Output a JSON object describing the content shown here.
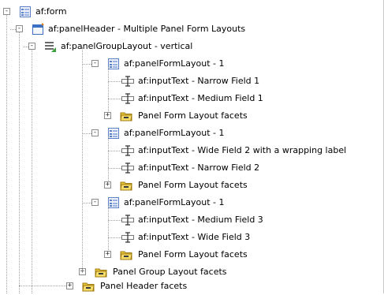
{
  "tree": {
    "nodes": [
      {
        "label": "af:form",
        "icon": "form-icon",
        "toggle": "-"
      },
      {
        "label": "af:panelHeader - Multiple Panel Form Layouts",
        "icon": "panel-header-icon",
        "toggle": "-"
      },
      {
        "label": "af:panelGroupLayout - vertical",
        "icon": "panel-group-layout-icon",
        "toggle": "-"
      },
      {
        "label": "af:panelFormLayout - 1",
        "icon": "panel-form-layout-icon",
        "toggle": "-"
      },
      {
        "label": "af:inputText - Narrow Field 1",
        "icon": "input-text-icon",
        "toggle": ""
      },
      {
        "label": "af:inputText - Medium Field 1",
        "icon": "input-text-icon",
        "toggle": ""
      },
      {
        "label": "Panel Form Layout facets",
        "icon": "facets-folder-icon",
        "toggle": "+"
      },
      {
        "label": "af:panelFormLayout - 1",
        "icon": "panel-form-layout-icon",
        "toggle": "-"
      },
      {
        "label": "af:inputText - Wide Field 2 with a wrapping label",
        "icon": "input-text-icon",
        "toggle": ""
      },
      {
        "label": "af:inputText - Narrow Field 2",
        "icon": "input-text-icon",
        "toggle": ""
      },
      {
        "label": "Panel Form Layout facets",
        "icon": "facets-folder-icon",
        "toggle": "+"
      },
      {
        "label": "af:panelFormLayout - 1",
        "icon": "panel-form-layout-icon",
        "toggle": "-"
      },
      {
        "label": "af:inputText - Medium Field 3",
        "icon": "input-text-icon",
        "toggle": ""
      },
      {
        "label": "af:inputText - Wide Field 3",
        "icon": "input-text-icon",
        "toggle": ""
      },
      {
        "label": "Panel Form Layout facets",
        "icon": "facets-folder-icon",
        "toggle": "+"
      },
      {
        "label": "Panel Group Layout facets",
        "icon": "facets-folder-icon",
        "toggle": "+"
      },
      {
        "label": "Panel Header facets",
        "icon": "facets-folder-icon",
        "toggle": "+"
      }
    ]
  },
  "colors": {
    "accent_blue": "#3a6fc4",
    "folder_yellow": "#e8c33a",
    "green": "#3aa03a"
  }
}
